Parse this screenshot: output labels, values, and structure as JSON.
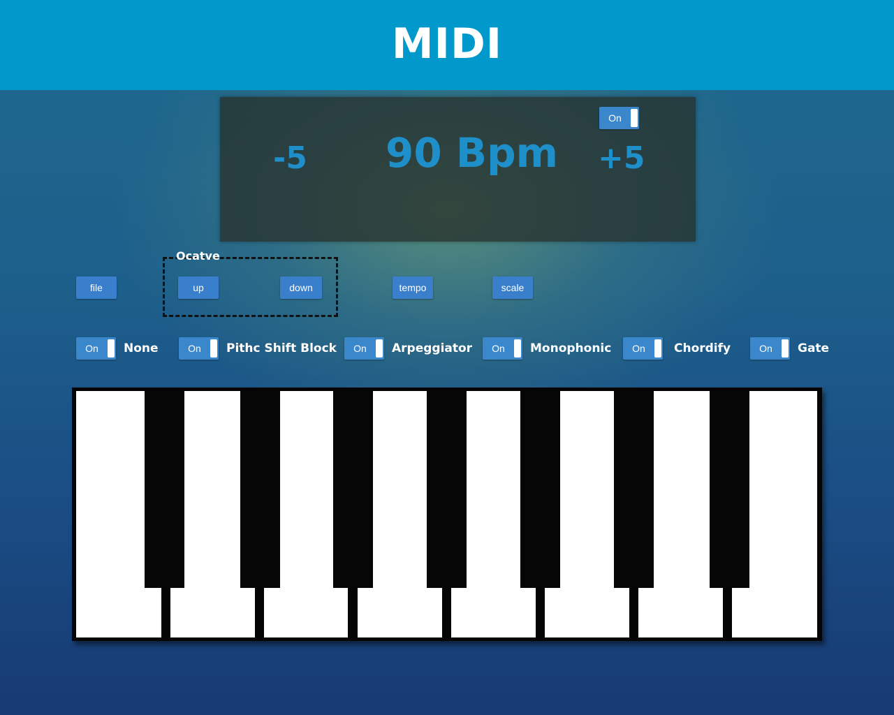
{
  "header": {
    "title": "MIDI"
  },
  "tempo_display": {
    "decrement": "-5",
    "bpm": "90 Bpm",
    "increment": "+5",
    "toggle_label": "On"
  },
  "controls": {
    "file_label": "file",
    "octave_group_label": "Ocatve",
    "up_label": "up",
    "down_label": "down",
    "tempo_label": "tempo",
    "scale_label": "scale"
  },
  "modes": [
    {
      "toggle_label": "On",
      "label": "None"
    },
    {
      "toggle_label": "On",
      "label": "Pithc Shift Block"
    },
    {
      "toggle_label": "On",
      "label": "Arpeggiator"
    },
    {
      "toggle_label": "On",
      "label": "Monophonic"
    },
    {
      "toggle_label": "On",
      "label": "Chordify"
    },
    {
      "toggle_label": "On",
      "label": "Gate"
    }
  ],
  "colors": {
    "header_bg": "#0198cc",
    "accent_text": "#1e8fc8",
    "button_bg": "#3a7fcc"
  },
  "keyboard": {
    "white_keys": 8,
    "black_keys": 7
  }
}
